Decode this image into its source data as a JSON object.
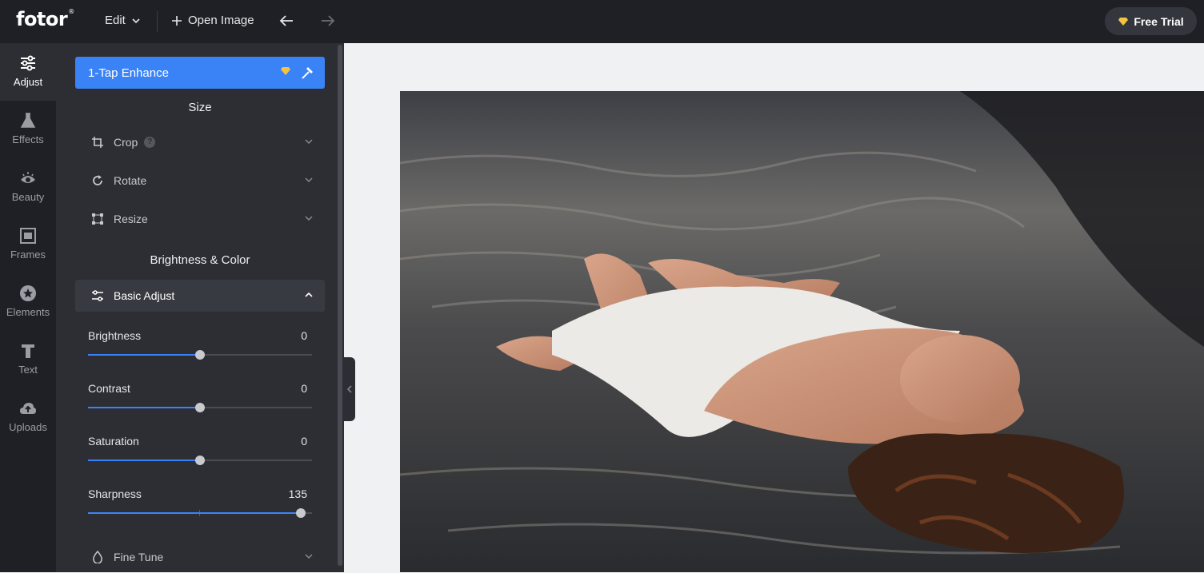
{
  "topbar": {
    "logo": "fotor",
    "logo_mark": "®",
    "edit_label": "Edit",
    "open_image_label": "Open Image",
    "free_trial_label": "Free Trial",
    "accent_color": "#3a83f7",
    "premium_color": "#f5c342"
  },
  "rail": [
    {
      "label": "Adjust",
      "icon": "sliders-icon",
      "active": true
    },
    {
      "label": "Effects",
      "icon": "flask-icon"
    },
    {
      "label": "Beauty",
      "icon": "eye-icon"
    },
    {
      "label": "Frames",
      "icon": "frame-icon"
    },
    {
      "label": "Elements",
      "icon": "star-icon"
    },
    {
      "label": "Text",
      "icon": "text-icon"
    },
    {
      "label": "Uploads",
      "icon": "cloud-upload-icon"
    }
  ],
  "panel": {
    "enhance_label": "1-Tap Enhance",
    "size_title": "Size",
    "crop_label": "Crop",
    "crop_help": "?",
    "rotate_label": "Rotate",
    "resize_label": "Resize",
    "brightness_color_title": "Brightness & Color",
    "basic_adjust_label": "Basic Adjust",
    "fine_tune_label": "Fine Tune",
    "sliders": [
      {
        "label": "Brightness",
        "value": "0",
        "fraction": 0.5
      },
      {
        "label": "Contrast",
        "value": "0",
        "fraction": 0.5
      },
      {
        "label": "Saturation",
        "value": "0",
        "fraction": 0.5
      },
      {
        "label": "Sharpness",
        "value": "135",
        "fraction": 0.95
      }
    ]
  }
}
